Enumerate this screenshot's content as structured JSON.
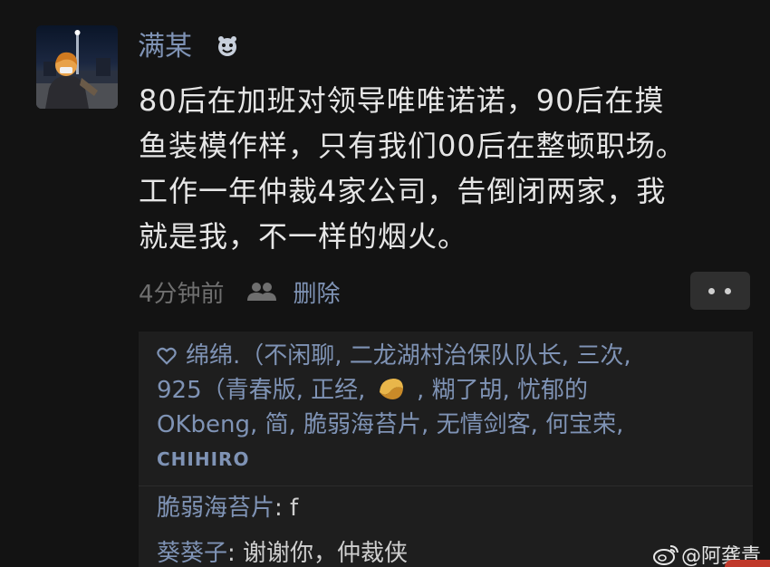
{
  "post": {
    "username": "满某",
    "content_lines": [
      "80后在加班对领导唯唯诺诺，90后在摸",
      "鱼装模作样，只有我们00后在整顿职场。",
      "工作一年仲裁4家公司，告倒闭两家，我",
      "就是我，不一样的烟火。"
    ],
    "time": "4分钟前",
    "delete_label": "删除"
  },
  "likes": {
    "line1": "绵绵.（不闲聊, 二龙湖村治保队队长, 三次,",
    "line2_a": "925（青春版, 正经,",
    "line2_b": ", 糊了胡, 忧郁的",
    "line3": "OKbeng, 简, 脆弱海苔片, 无情剑客, 何宝荣,",
    "line4": "CHIHIRO"
  },
  "comments": [
    {
      "author": "脆弱海苔片",
      "text": "f"
    },
    {
      "author": "葵葵子",
      "text": "谢谢你，仲裁侠"
    }
  ],
  "watermark": "@阿龚青",
  "colors": {
    "background": "#131313",
    "link": "#7f93b5",
    "text": "#e6e6e6",
    "muted": "#6f6f6f",
    "comment_bg": "#1e1e1e"
  },
  "icons": {
    "badge": "emoji-face-icon",
    "visibility": "friends-icon",
    "more": "more-dots-icon",
    "like": "heart-icon",
    "emoji": "fortune-cookie-icon",
    "watermark": "weibo-icon"
  }
}
